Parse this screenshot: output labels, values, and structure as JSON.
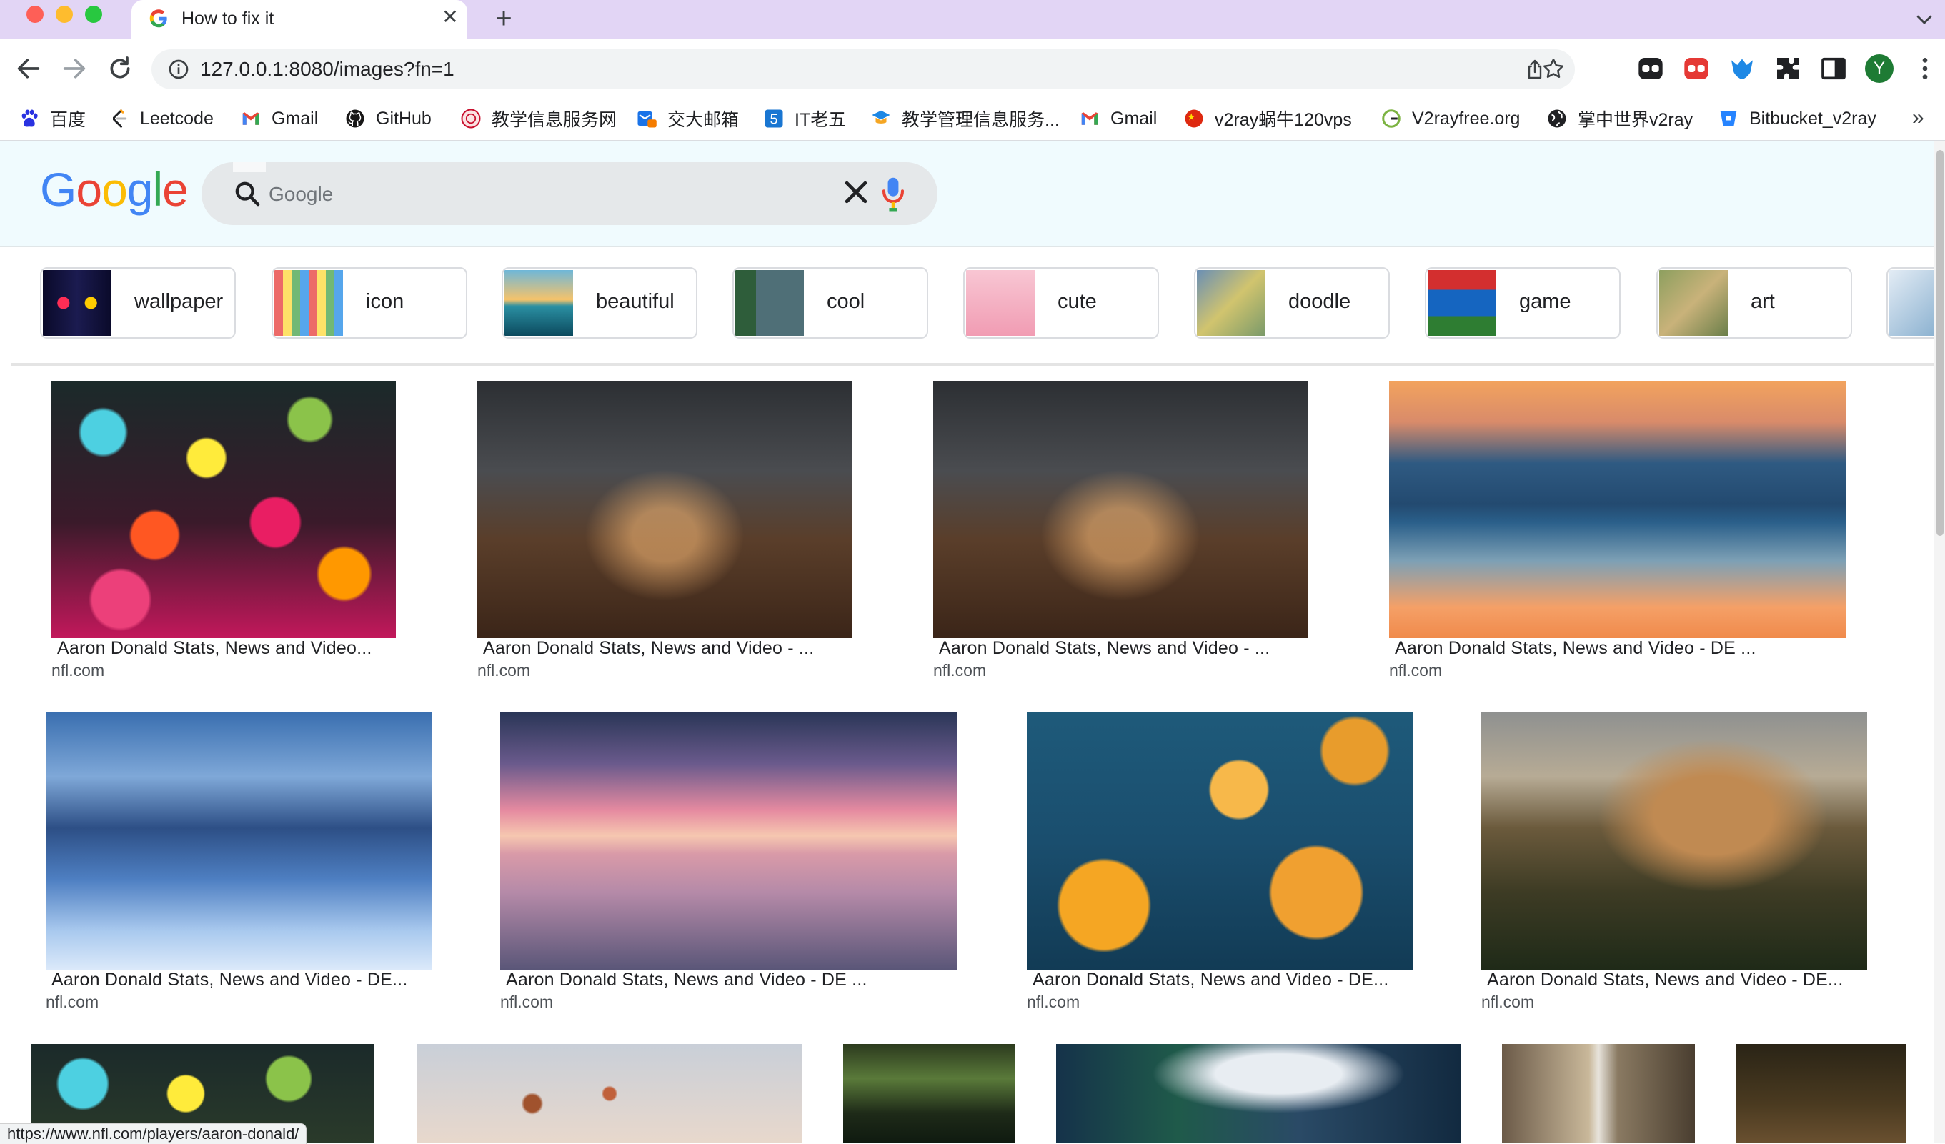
{
  "browser": {
    "tab_title": "How to fix it",
    "url": "127.0.0.1:8080/images?fn=1",
    "profile_initial": "Y",
    "status_url": "https://www.nfl.com/players/aaron-donald/",
    "bookmarks": [
      {
        "label": "百度",
        "icon": "baidu-paw-icon",
        "color": "#2932e1"
      },
      {
        "label": "Leetcode",
        "icon": "leetcode-icon",
        "color": "#ffa116"
      },
      {
        "label": "Gmail",
        "icon": "gmail-icon",
        "color": "#ea4335"
      },
      {
        "label": "GitHub",
        "icon": "github-icon",
        "color": "#181717"
      },
      {
        "label": "教学信息服务网",
        "icon": "sjtu-seal-icon",
        "color": "#c8102e"
      },
      {
        "label": "交大邮箱",
        "icon": "mail-box-icon",
        "color": "#1a73e8"
      },
      {
        "label": "IT老五",
        "icon": "it-five-icon",
        "color": "#1976d2"
      },
      {
        "label": "教学管理信息服务...",
        "icon": "graduation-icon",
        "color": "#f5a623"
      },
      {
        "label": "Gmail",
        "icon": "gmail-icon",
        "color": "#ea4335"
      },
      {
        "label": "v2ray蜗牛120vps",
        "icon": "china-flag-icon",
        "color": "#de2910"
      },
      {
        "label": "V2rayfree.org",
        "icon": "v2ray-g-icon",
        "color": "#7cb342"
      },
      {
        "label": "掌中世界v2ray",
        "icon": "globe-icon",
        "color": "#202124"
      },
      {
        "label": "Bitbucket_v2ray",
        "icon": "bitbucket-icon",
        "color": "#2684ff"
      }
    ]
  },
  "google": {
    "logo": [
      "G",
      "o",
      "o",
      "g",
      "l",
      "e"
    ],
    "logo_colors": [
      "#4285f4",
      "#ea4335",
      "#fbbc05",
      "#4285f4",
      "#34a853",
      "#ea4335"
    ],
    "search_placeholder": "Google",
    "chips": [
      {
        "label": "wallpaper"
      },
      {
        "label": "icon"
      },
      {
        "label": "beautiful"
      },
      {
        "label": "cool"
      },
      {
        "label": "cute"
      },
      {
        "label": "doodle"
      },
      {
        "label": "game"
      },
      {
        "label": "art"
      }
    ]
  },
  "results": [
    {
      "title": "Aaron Donald Stats, News and Video...",
      "source": "nfl.com"
    },
    {
      "title": "Aaron Donald Stats, News and Video - ...",
      "source": "nfl.com"
    },
    {
      "title": "Aaron Donald Stats, News and Video - ...",
      "source": "nfl.com"
    },
    {
      "title": "Aaron Donald Stats, News and Video - DE ...",
      "source": "nfl.com"
    },
    {
      "title": "Aaron Donald Stats, News and Video - DE...",
      "source": "nfl.com"
    },
    {
      "title": "Aaron Donald Stats, News and Video - DE ...",
      "source": "nfl.com"
    },
    {
      "title": "Aaron Donald Stats, News and Video - DE...",
      "source": "nfl.com"
    },
    {
      "title": "Aaron Donald Stats, News and Video - DE...",
      "source": "nfl.com"
    }
  ]
}
